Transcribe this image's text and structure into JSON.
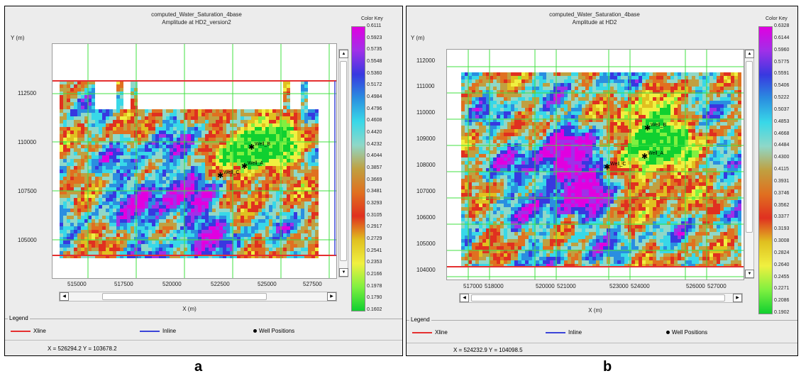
{
  "panels": {
    "a": {
      "title_line1": "computed_Water_Saturation_4base",
      "title_line2": "Amplitude at HD2_version2",
      "y_axis_label": "Y (m)",
      "x_axis_label": "X (m)",
      "y_ticks": [
        "112500",
        "110000",
        "107500",
        "105000"
      ],
      "x_ticks": [
        "515000",
        "517500",
        "520000",
        "522500",
        "525000",
        "527500"
      ],
      "color_key_title": "Color Key",
      "color_key_values": [
        "0.6111",
        "0.5923",
        "0.5735",
        "0.5548",
        "0.5360",
        "0.5172",
        "0.4984",
        "0.4796",
        "0.4608",
        "0.4420",
        "0.4232",
        "0.4044",
        "0.3857",
        "0.3669",
        "0.3481",
        "0.3293",
        "0.3105",
        "0.2917",
        "0.2729",
        "0.2541",
        "0.2353",
        "0.2166",
        "0.1978",
        "0.1790",
        "0.1602"
      ],
      "wells": [
        "Well_B",
        "Well_A",
        "Well_C"
      ],
      "status_text": "X =  526294.2  Y =   103678.2"
    },
    "b": {
      "title_line1": "computed_Water_Saturation_4base",
      "title_line2": "Amplitude at HD2",
      "y_axis_label": "Y (m)",
      "x_axis_label": "X (m)",
      "y_ticks": [
        "112000",
        "111000",
        "110000",
        "109000",
        "108000",
        "107000",
        "106000",
        "105000",
        "104000"
      ],
      "x_ticks": [
        "517000",
        "518000",
        "520000",
        "521000",
        "523000",
        "524000",
        "526000",
        "527000"
      ],
      "color_key_title": "Color Key",
      "color_key_values": [
        "0.6328",
        "0.6144",
        "0.5960",
        "0.5775",
        "0.5591",
        "0.5406",
        "0.5222",
        "0.5037",
        "0.4853",
        "0.4668",
        "0.4484",
        "0.4300",
        "0.4115",
        "0.3931",
        "0.3746",
        "0.3562",
        "0.3377",
        "0.3193",
        "0.3008",
        "0.2824",
        "0.2640",
        "0.2455",
        "0.2271",
        "0.2086",
        "0.1902"
      ],
      "wells": [
        "Well_B",
        "Well_A",
        "Well_C"
      ],
      "status_text": "X =  524232.9  Y =   104098.5"
    }
  },
  "legend": {
    "title": "Legend",
    "xline": "Xline",
    "inline": "Inline",
    "wells": "Well Positions",
    "xline_color": "#e53030",
    "inline_color": "#3a44d8"
  },
  "captions": {
    "a": "a",
    "b": "b"
  }
}
